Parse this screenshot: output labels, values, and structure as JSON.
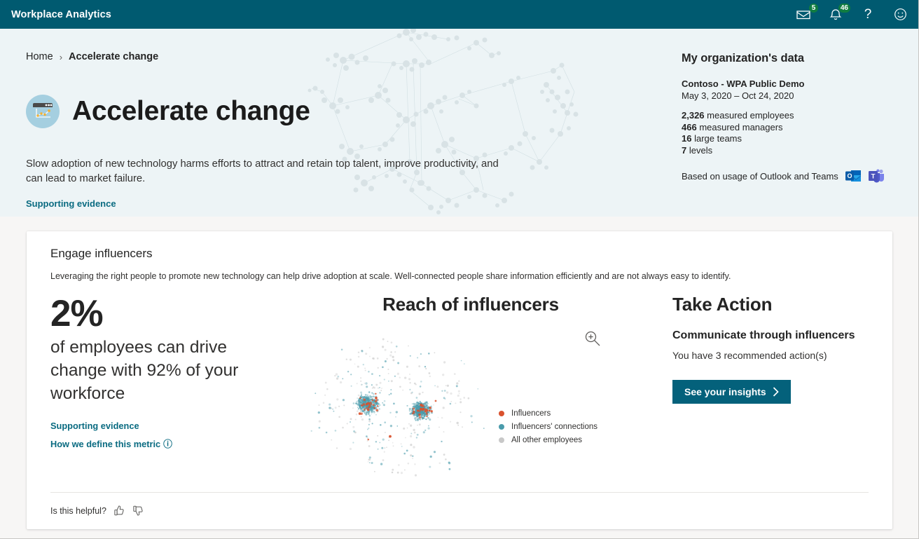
{
  "app": {
    "brand": "Workplace Analytics",
    "header_bg": "#005a70",
    "accent": "#0a6b81",
    "badge_color": "#107c41"
  },
  "topbar": {
    "icons": [
      {
        "name": "mail-icon",
        "badge": "5"
      },
      {
        "name": "bell-icon",
        "badge": "46"
      },
      {
        "name": "help-icon",
        "glyph": "?"
      },
      {
        "name": "feedback-smiley-icon",
        "glyph": "☺"
      }
    ]
  },
  "hero": {
    "breadcrumb": {
      "home": "Home",
      "separator": "›",
      "current": "Accelerate change"
    },
    "title": "Accelerate change",
    "icon_name": "accelerate-change-chart-icon",
    "description": "Slow adoption of new technology harms efforts to attract and retain top talent, improve productivity, and can lead to market failure.",
    "supporting_evidence_link": "Supporting evidence"
  },
  "org_data": {
    "heading": "My organization's data",
    "tenant": "Contoso - WPA Public Demo",
    "date_range": "May 3, 2020 – Oct 24, 2020",
    "stats": [
      {
        "num": "2,326",
        "label": "measured employees"
      },
      {
        "num": "466",
        "label": "measured managers"
      },
      {
        "num": "16",
        "label": "large teams"
      },
      {
        "num": "7",
        "label": "levels"
      }
    ],
    "based_on": "Based on usage of Outlook and Teams",
    "source_apps": [
      "outlook-icon",
      "teams-icon"
    ]
  },
  "card": {
    "title": "Engage influencers",
    "subtitle": "Leveraging the right people to promote new technology can help drive adoption at scale. Well-connected people share information efficiently and are not always easy to identify.",
    "metric": {
      "value": "2%",
      "description": "of employees can drive change with 92% of your workforce",
      "supporting_evidence_link": "Supporting evidence",
      "define_metric_link": "How we define this metric",
      "info_icon": "ⓘ"
    },
    "take_action": {
      "heading": "Take Action",
      "subheading": "Communicate through influencers",
      "description": "You have 3 recommended action(s)",
      "button_label": "See your insights",
      "button_chevron": "›",
      "button_color": "#04617b"
    },
    "footer": {
      "question": "Is this helpful?",
      "thumbs_up": "thumbs-up-icon",
      "thumbs_down": "thumbs-down-icon"
    }
  },
  "chart_data": {
    "type": "scatter",
    "title": "Reach of influencers",
    "xlabel": "",
    "ylabel": "",
    "grid": false,
    "legend_position": "right",
    "zoom_control": "zoom-in-icon",
    "series": [
      {
        "name": "Influencers",
        "color": "#d9522e",
        "approx_points": 55
      },
      {
        "name": "Influencers' connections",
        "color": "#4a9bab",
        "approx_points": 900
      },
      {
        "name": "All other employees",
        "color": "#c8c8c8",
        "approx_points": 180
      }
    ],
    "clusters": [
      {
        "cx": 0.33,
        "cy": 0.52,
        "spread": 0.11
      },
      {
        "cx": 0.62,
        "cy": 0.56,
        "spread": 0.1
      }
    ]
  }
}
